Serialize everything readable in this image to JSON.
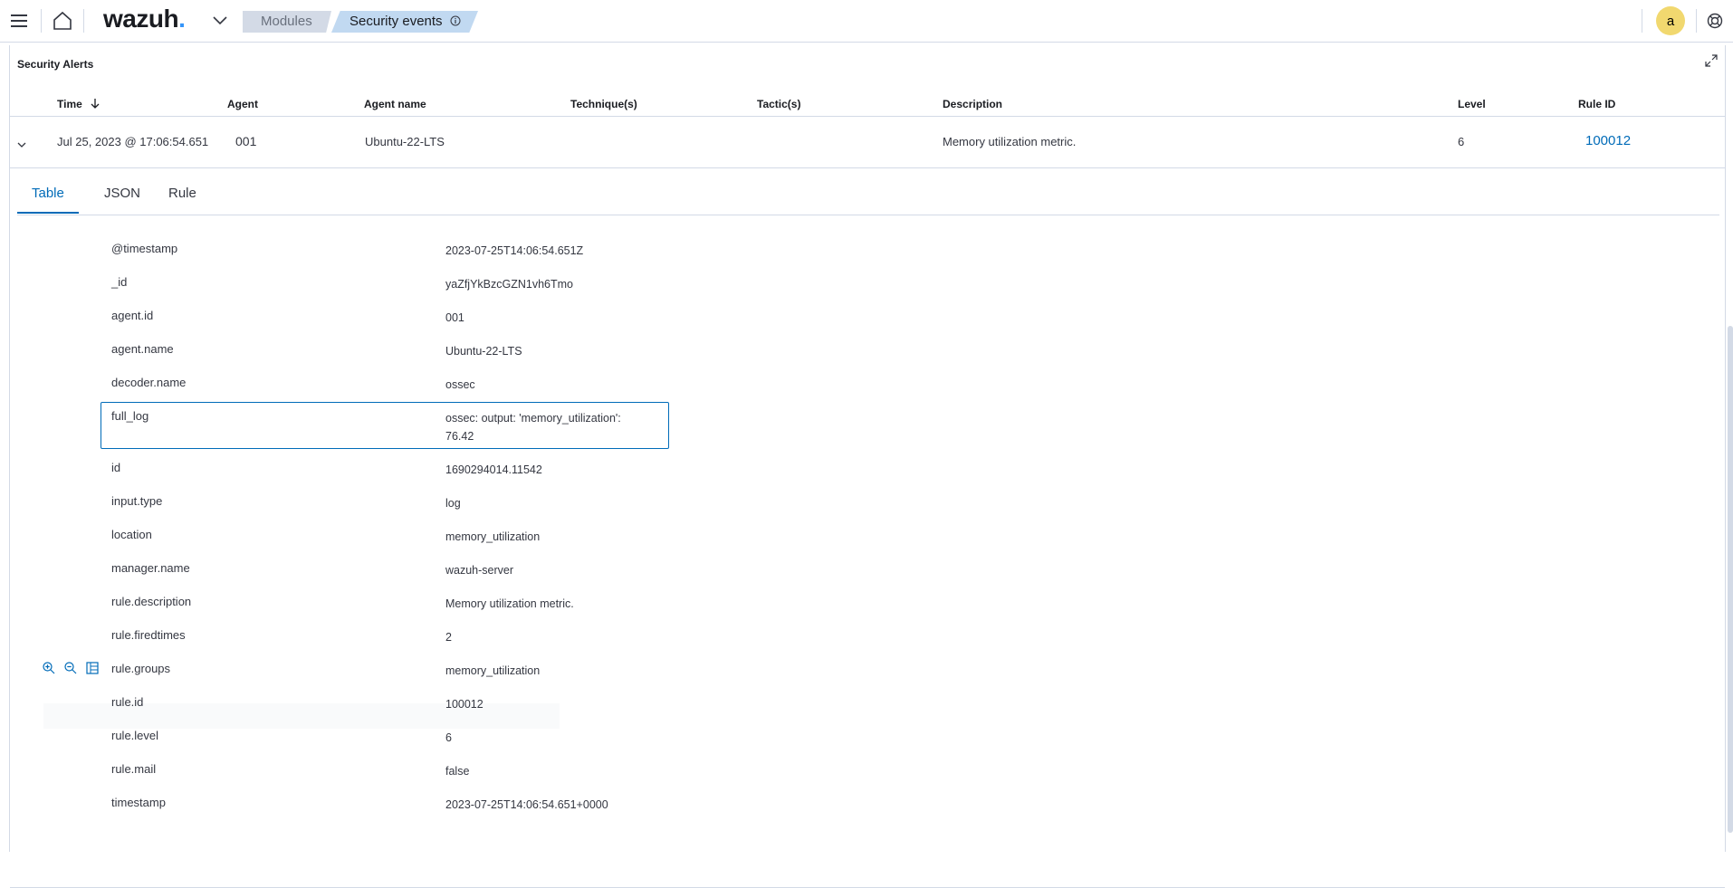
{
  "topbar": {
    "brand": "wazuh",
    "brand_dot": ".",
    "breadcrumbs": [
      "Modules",
      "Security events"
    ],
    "user_initial": "a"
  },
  "panel": {
    "title": "Security Alerts",
    "columns": {
      "time": "Time",
      "agent": "Agent",
      "agent_name": "Agent name",
      "techniques": "Technique(s)",
      "tactics": "Tactic(s)",
      "description": "Description",
      "level": "Level",
      "rule_id": "Rule ID"
    },
    "row": {
      "time": "Jul 25, 2023 @ 17:06:54.651",
      "agent": "001",
      "agent_name": "Ubuntu-22-LTS",
      "description": "Memory utilization metric.",
      "level": "6",
      "rule_id": "100012"
    }
  },
  "detail": {
    "tabs": [
      "Table",
      "JSON",
      "Rule"
    ],
    "fields": [
      {
        "key": "@timestamp",
        "value": "2023-07-25T14:06:54.651Z"
      },
      {
        "key": "_id",
        "value": "yaZfjYkBzcGZN1vh6Tmo"
      },
      {
        "key": "agent.id",
        "value": "001"
      },
      {
        "key": "agent.name",
        "value": "Ubuntu-22-LTS"
      },
      {
        "key": "decoder.name",
        "value": "ossec"
      },
      {
        "key": "full_log",
        "value": "ossec: output: 'memory_utilization':",
        "value2": "76.42"
      },
      {
        "key": "id",
        "value": "1690294014.11542"
      },
      {
        "key": "input.type",
        "value": "log"
      },
      {
        "key": "location",
        "value": "memory_utilization"
      },
      {
        "key": "manager.name",
        "value": "wazuh-server"
      },
      {
        "key": "rule.description",
        "value": "Memory utilization metric."
      },
      {
        "key": "rule.firedtimes",
        "value": "2"
      },
      {
        "key": "rule.groups",
        "value": "memory_utilization"
      },
      {
        "key": "rule.id",
        "value": "100012"
      },
      {
        "key": "rule.level",
        "value": "6"
      },
      {
        "key": "rule.mail",
        "value": "false"
      },
      {
        "key": "timestamp",
        "value": "2023-07-25T14:06:54.651+0000"
      }
    ]
  }
}
